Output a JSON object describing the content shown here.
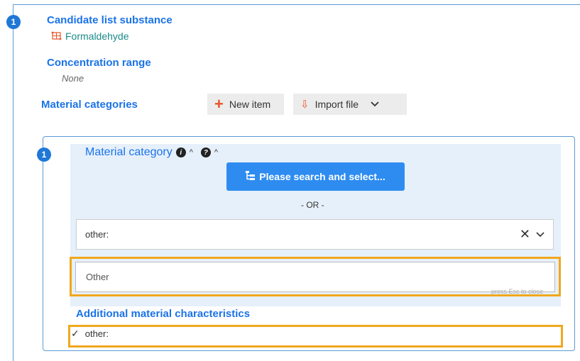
{
  "record": {
    "index": "1"
  },
  "candidate": {
    "title": "Candidate list substance",
    "substance": "Formaldehyde"
  },
  "concentration": {
    "title": "Concentration range",
    "value": "None"
  },
  "material_categories": {
    "title": "Material categories",
    "new_item_label": "New item",
    "import_file_label": "Import file"
  },
  "material_item": {
    "index": "1",
    "title": "Material category",
    "search_button_label": "Please search and select...",
    "or_text": "- OR -",
    "selected_value": "other:",
    "other_input_value": "Other",
    "esc_hint": "press Esc to close",
    "additional_title": "Additional material characteristics",
    "checked_item": "other:"
  },
  "colors": {
    "accent": "#1a73e8",
    "button_primary": "#2e8cf0",
    "highlight": "#f0a81c",
    "panel": "#e6f0fb",
    "icon_orange": "#e8552a"
  },
  "icons": [
    "molecule-icon",
    "plus-icon",
    "import-icon",
    "chevron-down-icon",
    "info-icon",
    "help-icon",
    "tree-icon",
    "clear-icon",
    "check-icon"
  ]
}
